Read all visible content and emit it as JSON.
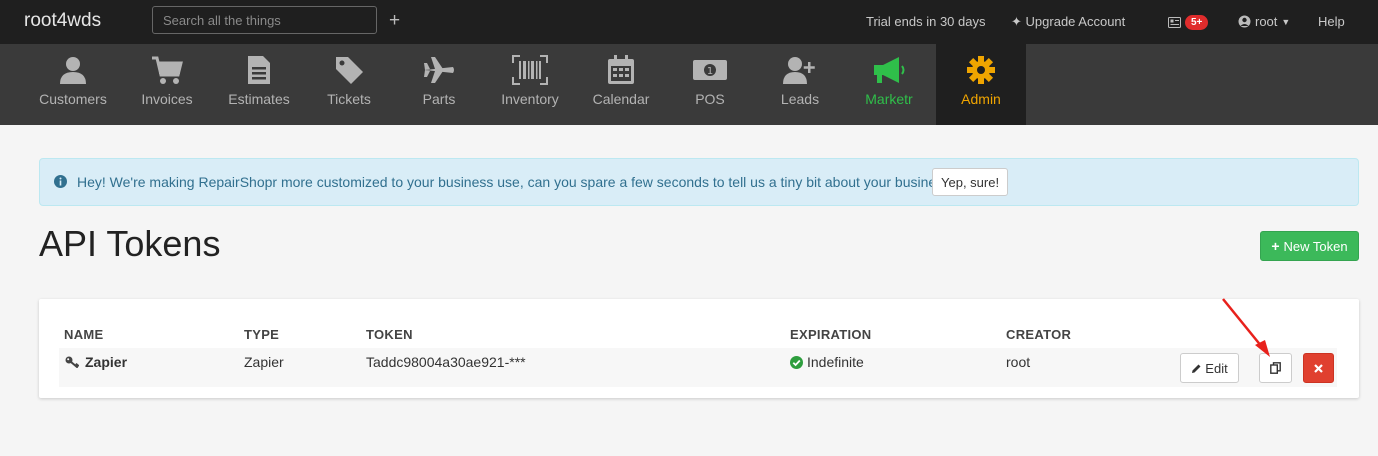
{
  "topbar": {
    "brand": "root4wds",
    "search_placeholder": "Search all the things",
    "plus": "+",
    "trial": "Trial ends in 30 days",
    "upgrade": "Upgrade Account",
    "notifications_badge": "5+",
    "user": "root",
    "help": "Help"
  },
  "nav": [
    {
      "label": "Customers",
      "icon": "user-icon"
    },
    {
      "label": "Invoices",
      "icon": "cart-icon"
    },
    {
      "label": "Estimates",
      "icon": "document-icon"
    },
    {
      "label": "Tickets",
      "icon": "tag-icon"
    },
    {
      "label": "Parts",
      "icon": "plane-icon"
    },
    {
      "label": "Inventory",
      "icon": "barcode-icon"
    },
    {
      "label": "Calendar",
      "icon": "calendar-icon"
    },
    {
      "label": "POS",
      "icon": "money-icon"
    },
    {
      "label": "Leads",
      "icon": "user-plus-icon"
    },
    {
      "label": "Marketr",
      "icon": "megaphone-icon"
    },
    {
      "label": "Admin",
      "icon": "gear-icon"
    }
  ],
  "alert": {
    "message": "Hey! We're making RepairShopr more customized to your business use, can you spare a few seconds to tell us a tiny bit about your business?",
    "button": "Yep, sure!"
  },
  "page": {
    "title": "API Tokens",
    "new_token": "New Token"
  },
  "table": {
    "columns": [
      "NAME",
      "TYPE",
      "TOKEN",
      "EXPIRATION",
      "CREATOR"
    ],
    "rows": [
      {
        "name": "Zapier",
        "type": "Zapier",
        "token": "Taddc98004a30ae921-***",
        "expiration": "Indefinite",
        "creator": "root",
        "edit": "Edit"
      }
    ]
  },
  "colors": {
    "topbar": "#1f1f1f",
    "nav": "#3a3a3a",
    "marketr": "#2fbf4a",
    "admin": "#f0a500",
    "success": "#3cb95a",
    "danger": "#e0402f"
  }
}
